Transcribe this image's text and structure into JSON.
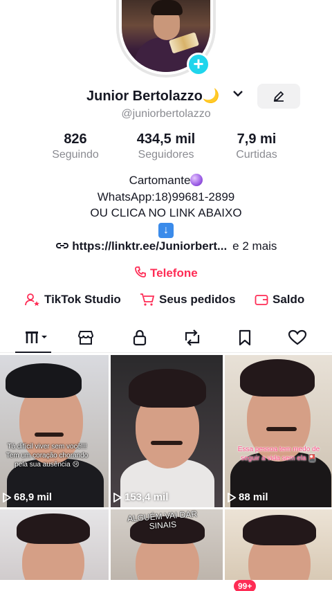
{
  "profile": {
    "name": "Junior Bertolazzo🌙",
    "handle": "@juniorbertolazzo",
    "stats": [
      {
        "value": "826",
        "label": "Seguindo"
      },
      {
        "value": "434,5 mil",
        "label": "Seguidores"
      },
      {
        "value": "7,9 mi",
        "label": "Curtidas"
      }
    ],
    "bio_line1": "Cartomante",
    "bio_line2": "WhatsApp:18)99681-2899",
    "bio_line3": "OU CLICA NO LINK ABAIXO",
    "link": "https://linktr.ee/Juniorbert...",
    "link_more": "e 2 mais",
    "phone_label": "Telefone"
  },
  "tools": {
    "studio": "TikTok Studio",
    "orders": "Seus pedidos",
    "balance": "Saldo"
  },
  "tabs": [
    "videos-tab",
    "shop-tab",
    "private-tab",
    "reposts-tab",
    "saved-tab",
    "liked-tab"
  ],
  "videos": [
    {
      "views": "68,9 mil",
      "caption": "Tá difícil viver sem você!!! Tem um coração chorando pela sua ausência 😢"
    },
    {
      "views": "153,4 mil",
      "caption": ""
    },
    {
      "views": "88 mil",
      "caption": "Essa pessoa tem medo de seguir a vida sem ela 🎴"
    },
    {
      "views": "",
      "caption": ""
    },
    {
      "views": "",
      "caption": "ALGUÉM VAI DAR SINAIS"
    },
    {
      "views": "",
      "caption": ""
    }
  ],
  "nav": {
    "inbox_badge": "99+"
  },
  "colors": {
    "accent": "#fe2c55",
    "text": "#161823",
    "muted": "#8a8b91",
    "plus": "#20d5ec"
  }
}
